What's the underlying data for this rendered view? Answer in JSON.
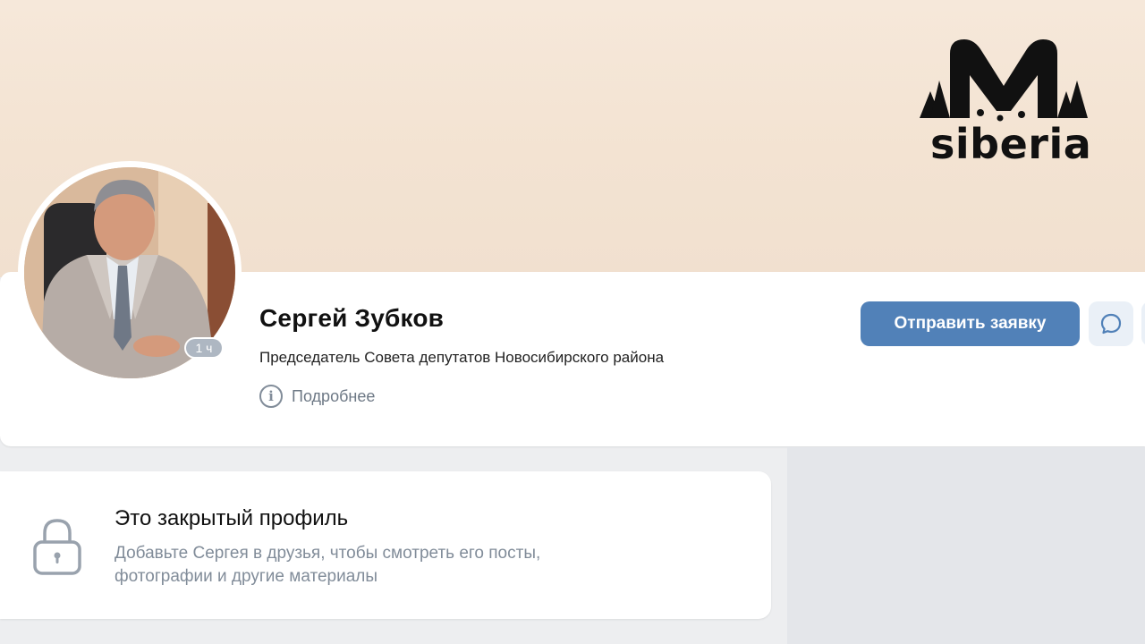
{
  "watermark": {
    "text": "siberia",
    "icon": "ngs-siberia-logo"
  },
  "profile": {
    "name": "Сергей Зубков",
    "status_line": "Председатель Совета депутатов Новосибирского района",
    "last_seen": "1 ч",
    "more_label": "Подробнее",
    "avatar_icon": "profile-photo"
  },
  "actions": {
    "send_request_label": "Отправить заявку",
    "message_icon": "message-bubble-icon"
  },
  "closed_profile": {
    "title": "Это закрытый профиль",
    "line1": "Добавьте Сергея в друзья, чтобы смотреть его посты,",
    "line2": "фотографии и другие материалы",
    "icon": "lock-icon"
  },
  "colors": {
    "accent": "#5181b8",
    "cover": "#f4e5d5",
    "muted_text": "#818c99",
    "page_bg": "#edeef0"
  }
}
